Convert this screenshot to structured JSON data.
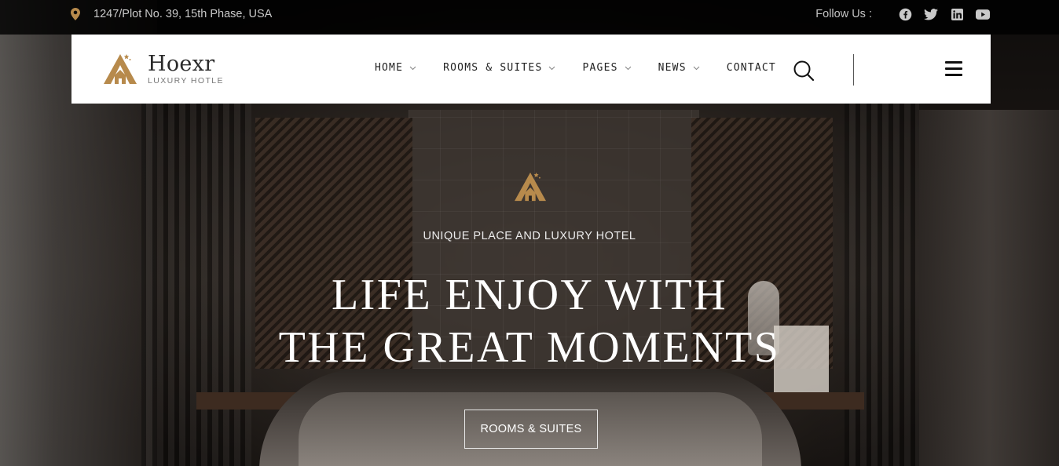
{
  "topbar": {
    "address": "1247/Plot No. 39, 15th Phase, USA",
    "address_icon": "map-pin-icon",
    "follow_label": "Follow Us :",
    "social": [
      {
        "name": "facebook-icon"
      },
      {
        "name": "twitter-icon"
      },
      {
        "name": "linkedin-icon"
      },
      {
        "name": "youtube-icon"
      }
    ]
  },
  "brand": {
    "name": "Hoexr",
    "tagline": "LUXURY HOTLE",
    "accent": "#b78a4c"
  },
  "nav": {
    "items": [
      {
        "label": "HOME",
        "has_dropdown": true
      },
      {
        "label": "ROOMS & SUITES",
        "has_dropdown": true
      },
      {
        "label": "PAGES",
        "has_dropdown": true
      },
      {
        "label": "NEWS",
        "has_dropdown": true
      },
      {
        "label": "CONTACT",
        "has_dropdown": false
      }
    ],
    "search_icon": "search-icon",
    "menu_icon": "hamburger-menu-icon"
  },
  "hero": {
    "eyebrow": "UNIQUE PLACE AND LUXURY HOTEL",
    "title_line1": "LIFE ENJOY WITH",
    "title_line2": "THE GREAT MOMENTS",
    "cta_label": "ROOMS & SUITES"
  }
}
